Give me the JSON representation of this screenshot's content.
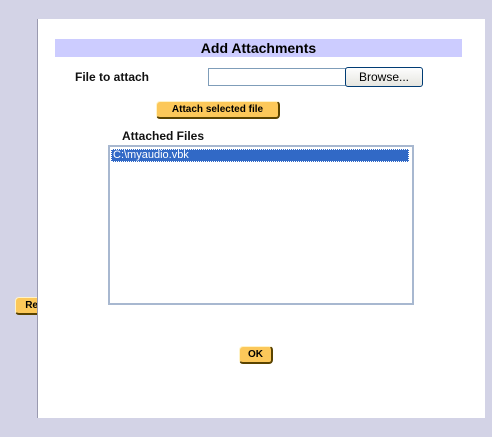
{
  "dialog": {
    "title": "Add Attachments",
    "file_label": "File to attach",
    "file_value": "",
    "browse_label": "Browse...",
    "attach_label": "Attach selected file",
    "attached_label": "Attached Files",
    "attached_files": [
      "C:\\myaudio.vbk"
    ],
    "remove_label": "Remove attachments",
    "ok_label": "OK"
  },
  "colors": {
    "page_bg": "#d3d3e6",
    "title_bar": "#ccccff",
    "gold_button": "#fcc85a",
    "selection": "#3169c6"
  }
}
